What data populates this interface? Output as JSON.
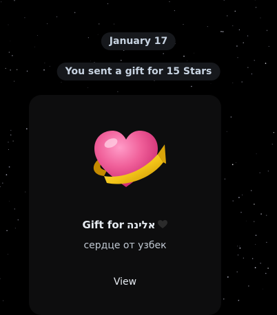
{
  "chat": {
    "date_label": "January 17",
    "service_message": "You sent a gift for 15 Stars"
  },
  "gift": {
    "title_prefix": "Gift for",
    "recipient_name": "אלינה",
    "recipient_emoji_icon": "black-heart-icon",
    "message": "сердце от узбек",
    "view_label": "View",
    "sticker_icon": "heart-with-ribbon-icon"
  },
  "colors": {
    "background": "#000000",
    "pill_background": "#16181c",
    "card_background": "#0d0d0e",
    "heart_pink": "#f0609a",
    "ribbon_gold": "#f2c418"
  }
}
